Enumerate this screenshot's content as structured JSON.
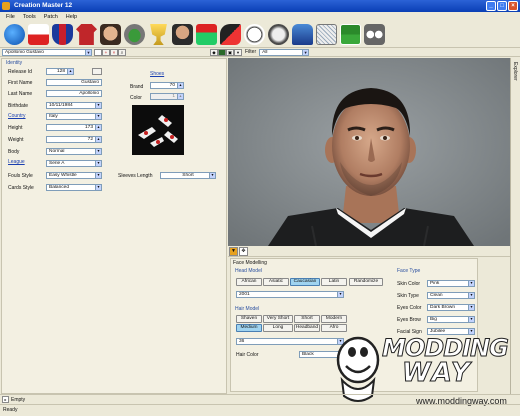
{
  "window": {
    "title": "Creation Master 12",
    "min": "_",
    "max": "□",
    "close": "×"
  },
  "menu": [
    "File",
    "Tools",
    "Patch",
    "Help"
  ],
  "selector": {
    "player": "Apollonio Gustavo",
    "search_placeholder": "",
    "filter_label": "Filter",
    "filter_value": "All"
  },
  "identity": {
    "group": "Identity",
    "release_id_label": "Release Id",
    "release_id": "128",
    "first_name_label": "First Name",
    "first_name": "Gustavo",
    "last_name_label": "Last Name",
    "last_name": "Apollonio",
    "birthdate_label": "Birthdate",
    "birthdate": "10/11/1984",
    "country_label": "Country",
    "country": "Italy",
    "height_label": "Height",
    "height": "173",
    "weight_label": "Weight",
    "weight": "72",
    "body_label": "Body",
    "body": "Normal",
    "league_label": "League",
    "league": "Serie A",
    "fouls_label": "Fouls Style",
    "fouls": "Easy Whistle",
    "cards_label": "Cards Style",
    "cards": "Balanced"
  },
  "shoes": {
    "group": "Shoes",
    "brand_label": "Brand",
    "brand": "70",
    "color_label": "Color",
    "color": "1",
    "sleeves_label": "Sleeves Length",
    "sleeves": "Short"
  },
  "face": {
    "group": "Face Modelling",
    "head_model_label": "Head Model",
    "head_buttons": [
      "African",
      "Asiatic",
      "Caucasian",
      "Latin"
    ],
    "head_selected": "Caucasian",
    "randomize": "Randomize",
    "head_id": "2001",
    "hair_model_label": "Hair Model",
    "hair_row1": [
      "Shaven",
      "Very Short",
      "Short",
      "Modern"
    ],
    "hair_row2": [
      "Medium",
      "Long",
      "Headband",
      "Afro"
    ],
    "hair_selected": "Medium",
    "hair_id": "36",
    "hair_color_label": "Hair Color",
    "hair_color": "Black",
    "face_type_label": "Face Type",
    "skin_color_label": "Skin Color",
    "skin_color": "Pink",
    "skin_type_label": "Skin Type",
    "skin_type": "Clean",
    "eyes_color_label": "Eyes Color",
    "eyes_color": "Dark Brown",
    "eyes_brow_label": "Eyes Brow",
    "eyes_brow": "Big",
    "facial_sign_label": "Facial Sign",
    "facial_sign": "Jubilee"
  },
  "right_tab": "Explorer",
  "status": {
    "bottom_tab": "Empty",
    "ready": "Ready"
  },
  "watermark": {
    "text1": "MODDING",
    "text2": "WAY",
    "url": "www.moddingway.com"
  },
  "colors": {
    "titlebar": "#0a3fb5",
    "selected": "#9fd3f0",
    "viewport": "#7f8588",
    "jersey": "#1d1e1f"
  }
}
